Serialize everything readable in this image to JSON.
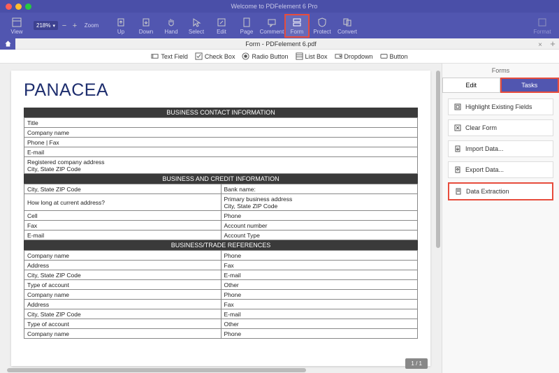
{
  "window": {
    "title": "Welcome to PDFelement 6 Pro"
  },
  "toolbar": {
    "buttons": [
      "View",
      "Zoom",
      "",
      "Up",
      "Down",
      "Hand",
      "Select",
      "Edit",
      "Page",
      "Comment",
      "Form",
      "Protect",
      "Convert"
    ],
    "zoom_value": "218%",
    "format_label": "Format"
  },
  "tab": {
    "name": "Form - PDFelement 6.pdf"
  },
  "formtools": [
    "Text Field",
    "Check Box",
    "Radio Button",
    "List Box",
    "Dropdown",
    "Button"
  ],
  "document": {
    "title": "PANACEA",
    "sections": [
      {
        "header": "BUSINESS CONTACT INFORMATION",
        "rows": [
          [
            "Title"
          ],
          [
            "Company name"
          ],
          [
            "Phone | Fax"
          ],
          [
            "E-mail"
          ],
          [
            "Registered company address\nCity, State ZIP Code"
          ]
        ]
      },
      {
        "header": "BUSINESS AND CREDIT INFORMATION",
        "rows": [
          [
            "City, State ZIP Code",
            "Bank name:"
          ],
          [
            "How long at current address?",
            "Primary business address\nCity, State ZIP Code"
          ],
          [
            "Cell",
            "Phone"
          ],
          [
            "Fax",
            "Account number"
          ],
          [
            "E-mail",
            "Account Type"
          ]
        ]
      },
      {
        "header": "BUSINESS/TRADE REFERENCES",
        "rows": [
          [
            "Company name",
            "Phone"
          ],
          [
            "Address",
            "Fax"
          ],
          [
            "City, State ZIP Code",
            "E-mail"
          ],
          [
            "Type of account",
            "Other"
          ],
          [
            "Company name",
            "Phone"
          ],
          [
            "Address",
            "Fax"
          ],
          [
            "City, State ZIP Code",
            "E-mail"
          ],
          [
            "Type of account",
            "Other"
          ],
          [
            "Company name",
            "Phone"
          ]
        ]
      }
    ],
    "page_indicator": "1 / 1"
  },
  "sidebar": {
    "header": "Forms",
    "tabs": [
      "Edit",
      "Tasks"
    ],
    "items": [
      "Highlight Existing Fields",
      "Clear Form",
      "Import Data...",
      "Export Data...",
      "Data Extraction"
    ]
  }
}
